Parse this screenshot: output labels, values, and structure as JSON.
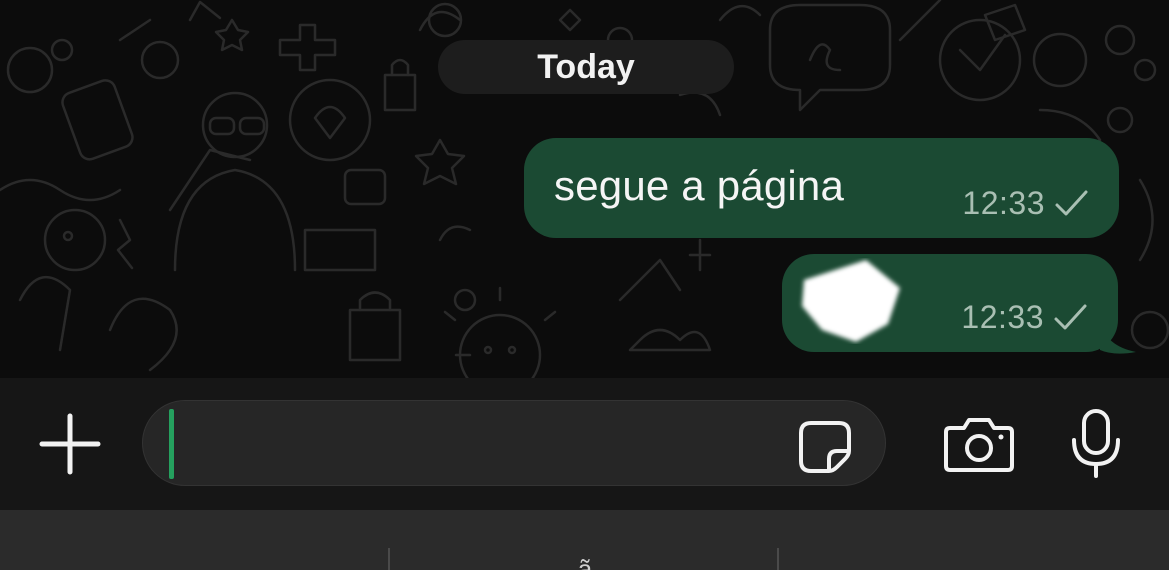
{
  "chat": {
    "date_separator": "Today",
    "messages": [
      {
        "text": "segue a página",
        "time": "12:33",
        "status_icon": "single-check-icon",
        "direction": "outgoing"
      },
      {
        "text": "",
        "content_icon": "redacted-image-icon",
        "time": "12:33",
        "status_icon": "single-check-icon",
        "direction": "outgoing"
      }
    ]
  },
  "composer": {
    "attach_icon": "plus-icon",
    "input_value": "",
    "sticker_icon": "sticker-icon",
    "camera_icon": "camera-icon",
    "mic_icon": "microphone-icon"
  },
  "keyboard": {
    "suggestions": [
      "",
      "ã",
      ""
    ]
  },
  "colors": {
    "outgoing_bubble": "#1b4a33",
    "chat_background": "#0c0c0c",
    "composer_background": "#161616",
    "input_background": "#262626",
    "cursor": "#25a05e",
    "timestamp": "#a9bfb3"
  }
}
